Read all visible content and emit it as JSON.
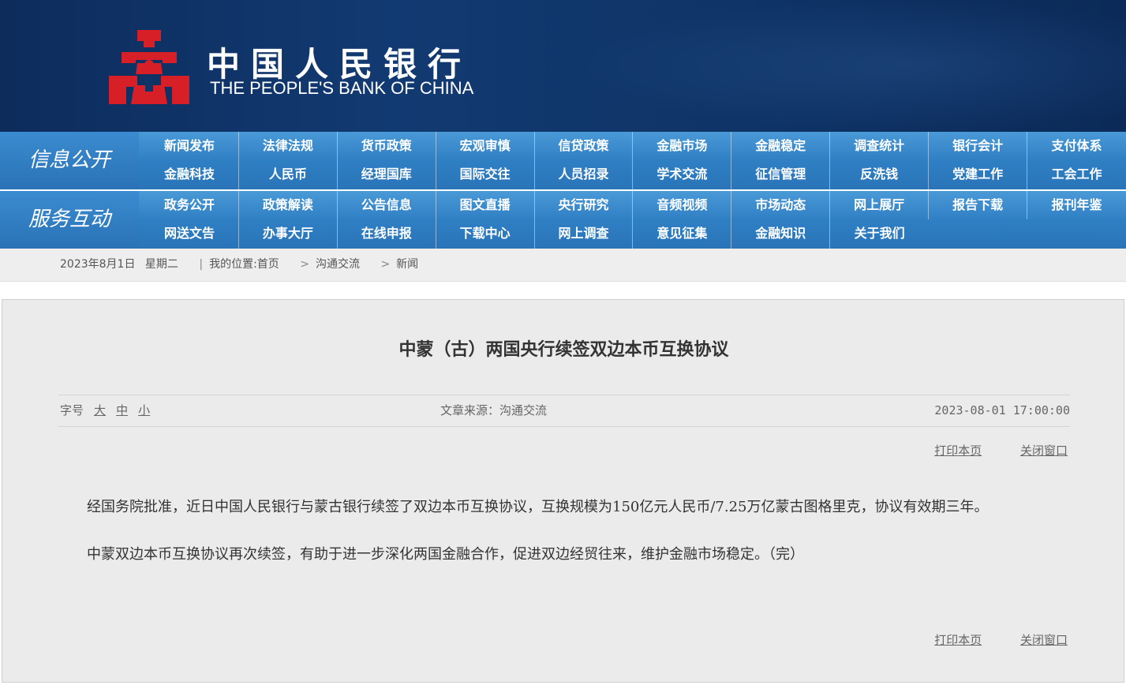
{
  "header": {
    "org_name_cn": "中国人民银行",
    "org_name_en": "THE PEOPLE'S BANK OF CHINA",
    "logo_icon": "pboc-emblem-icon",
    "emblem_color": "#d61f26"
  },
  "nav_info": {
    "title": "信息公开",
    "items": [
      "新闻发布",
      "法律法规",
      "货币政策",
      "宏观审慎",
      "信贷政策",
      "金融市场",
      "金融稳定",
      "调查统计",
      "银行会计",
      "支付体系",
      "金融科技",
      "人民币",
      "经理国库",
      "国际交往",
      "人员招录",
      "学术交流",
      "征信管理",
      "反洗钱",
      "党建工作",
      "工会工作"
    ]
  },
  "nav_service": {
    "title": "服务互动",
    "items": [
      "政务公开",
      "政策解读",
      "公告信息",
      "图文直播",
      "央行研究",
      "音频视频",
      "市场动态",
      "网上展厅",
      "报告下载",
      "报刊年鉴",
      "网送文告",
      "办事大厅",
      "在线申报",
      "下载中心",
      "网上调查",
      "意见征集",
      "金融知识",
      "关于我们"
    ]
  },
  "breadcrumb": {
    "date": "2023年8月1日",
    "weekday": "星期二",
    "location_label": "我的位置:首页",
    "crumbs": [
      "沟通交流",
      "新闻"
    ]
  },
  "article": {
    "title": "中蒙（古）两国央行续签双边本币互换协议",
    "font_size_label": "字号",
    "font_sizes": [
      "大",
      "中",
      "小"
    ],
    "source": "文章来源：沟通交流",
    "datetime": "2023-08-01 17:00:00",
    "print_label": "打印本页",
    "close_label": "关闭窗口",
    "paragraphs": [
      "经国务院批准，近日中国人民银行与蒙古银行续签了双边本币互换协议，互换规模为150亿元人民币/7.25万亿蒙古图格里克，协议有效期三年。",
      "中蒙双边本币互换协议再次续签，有助于进一步深化两国金融合作，促进双边经贸往来，维护金融市场稳定。（完）"
    ]
  }
}
